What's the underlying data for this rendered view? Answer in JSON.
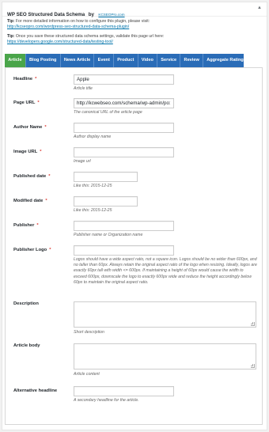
{
  "header": {
    "title": "WP SEO Structured Data Schema",
    "by": "by",
    "brand": "KCSEOPro.com",
    "toggle": "▲"
  },
  "tips": [
    {
      "label": "Tip:",
      "text": "For more detailed information on how to configure this plugin, please visit:",
      "link": "http://kcseopro.com/wordpress-seo-structured-data-schema-plugin/"
    },
    {
      "label": "Tip:",
      "text": "Once you save these structured data schema settings, validate this page url here:",
      "link": "https://developers.google.com/structured-data/testing-tool/"
    }
  ],
  "tabs": [
    "Article",
    "Blog Posting",
    "News Article",
    "Event",
    "Product",
    "Video",
    "Service",
    "Review",
    "Aggregate Ratings"
  ],
  "active_tab": "Article",
  "fields": {
    "headline": {
      "label": "Headline",
      "value": "Apple",
      "hint": "Article title"
    },
    "page_url": {
      "label": "Page URL",
      "value": "http://kcwebseo.com/schema/wp-admin/po:",
      "hint": "The canonical URL of the article page"
    },
    "author_name": {
      "label": "Author Name",
      "value": "",
      "hint": "Author display name"
    },
    "image_url": {
      "label": "Image URL",
      "value": "",
      "hint": "Image url"
    },
    "published_date": {
      "label": "Published date",
      "value": "",
      "hint": "Like this: 2015-12-25"
    },
    "modified_date": {
      "label": "Modified date",
      "value": "",
      "hint": "Like this: 2015-12-25"
    },
    "publisher": {
      "label": "Publisher",
      "value": "",
      "hint": "Publisher name or Organization name"
    },
    "publisher_logo": {
      "label": "Publisher Logo",
      "value": "",
      "hint": "Logos should have a wide aspect ratio, not a square icon. Logos should be no wider than 600px, and no taller than 60px. Always retain the original aspect ratio of the logo when resizing. Ideally, logos are exactly 60px tall with width <= 600px. If maintaining a height of 60px would cause the width to exceed 600px, downscale the logo to exactly 600px wide and reduce the height accordingly below 60px to maintain the original aspect ratio."
    },
    "description": {
      "label": "Description",
      "value": "",
      "hint": "Short description"
    },
    "article_body": {
      "label": "Article body",
      "value": "",
      "hint": "Article content"
    },
    "alternative_headline": {
      "label": "Alternative headline",
      "value": "",
      "hint": "A secondary headline for the article."
    }
  },
  "required_mark": "*",
  "colors": {
    "tab_bar": "#2a6cb7",
    "active_tab": "#4aa54a",
    "link": "#0073aa",
    "required": "#dd3d36"
  }
}
